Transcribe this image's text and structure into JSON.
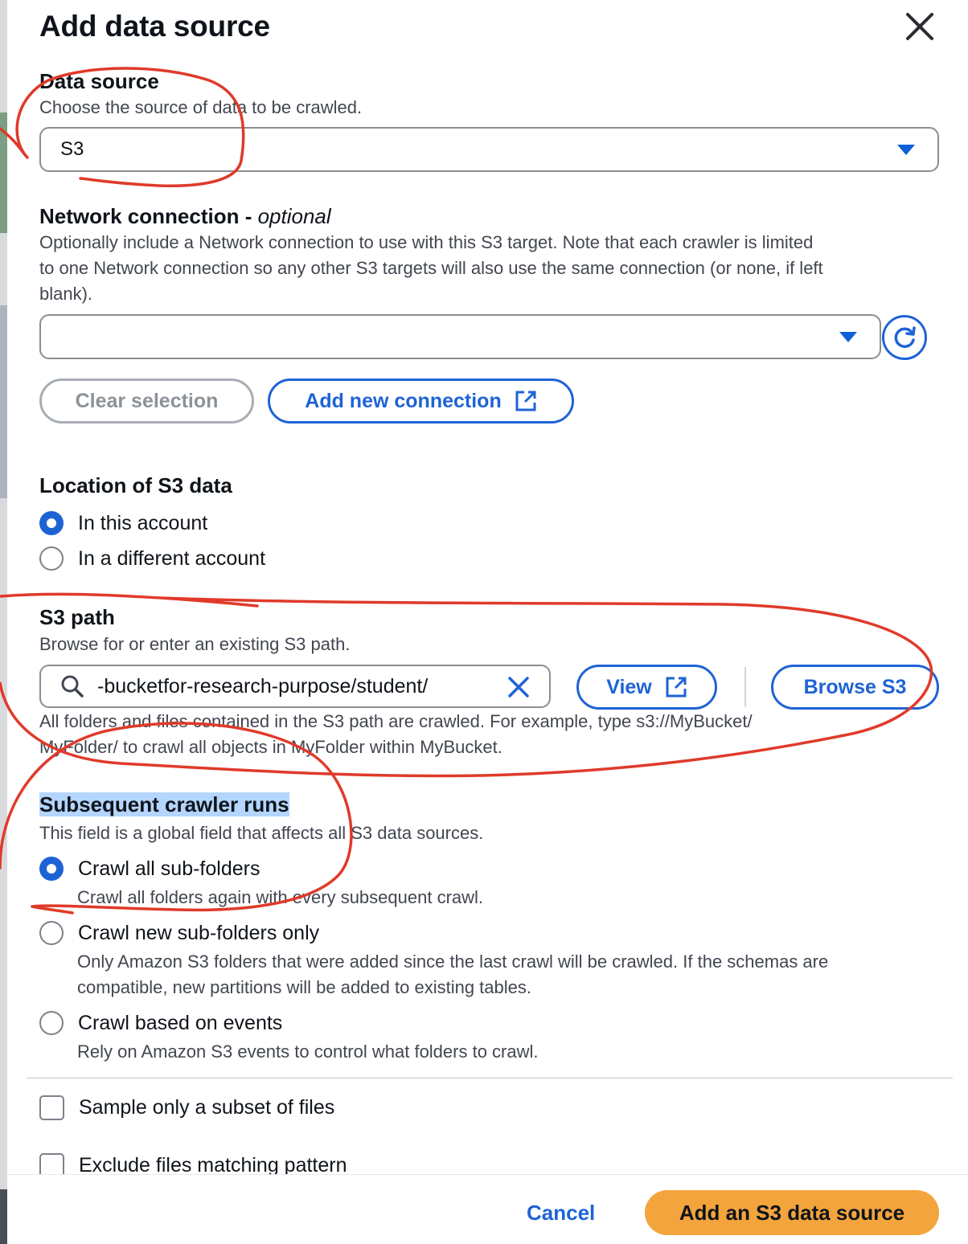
{
  "modal": {
    "title": "Add data source"
  },
  "data_source": {
    "label": "Data source",
    "description": "Choose the source of data to be crawled.",
    "selected": "S3"
  },
  "network": {
    "label": "Network connection - ",
    "label_optional": "optional",
    "description_line1": "Optionally include a Network connection to use with this S3 target. Note that each crawler is limited",
    "description_line2": "to one Network connection so any other S3 targets will also use the same connection (or none, if left",
    "description_line3": "blank).",
    "selected": "",
    "clear_label": "Clear selection",
    "add_label": "Add new connection"
  },
  "location": {
    "label": "Location of S3 data",
    "options": [
      {
        "label": "In this account",
        "selected": true
      },
      {
        "label": "In a different account",
        "selected": false
      }
    ]
  },
  "s3_path": {
    "label": "S3 path",
    "description": "Browse for or enter an existing S3 path.",
    "value": "-bucketfor-research-purpose/student/",
    "view_label": "View",
    "browse_label": "Browse S3",
    "help_line1": "All folders and files contained in the S3 path are crawled. For example, type s3://MyBucket/",
    "help_line2": "MyFolder/ to crawl all objects in MyFolder within MyBucket."
  },
  "subsequent": {
    "label": "Subsequent crawler runs",
    "description": "This field is a global field that affects all S3 data sources.",
    "options": [
      {
        "label": "Crawl all sub-folders",
        "sub": "Crawl all folders again with every subsequent crawl.",
        "selected": true
      },
      {
        "label": "Crawl new sub-folders only",
        "sub_line1": "Only Amazon S3 folders that were added since the last crawl will be crawled. If the schemas are",
        "sub_line2": "compatible, new partitions will be added to existing tables.",
        "selected": false
      },
      {
        "label": "Crawl based on events",
        "sub": "Rely on Amazon S3 events to control what folders to crawl.",
        "selected": false
      }
    ]
  },
  "checkboxes": [
    {
      "label": "Sample only a subset of files",
      "checked": false
    },
    {
      "label": "Exclude files matching pattern",
      "checked": false
    }
  ],
  "footer": {
    "cancel_label": "Cancel",
    "submit_label": "Add an S3 data source"
  },
  "colors": {
    "accent": "#1e63d6",
    "primary_button": "#f4a43c",
    "annotation": "#e03a2a",
    "highlight": "#b4d5fe"
  }
}
